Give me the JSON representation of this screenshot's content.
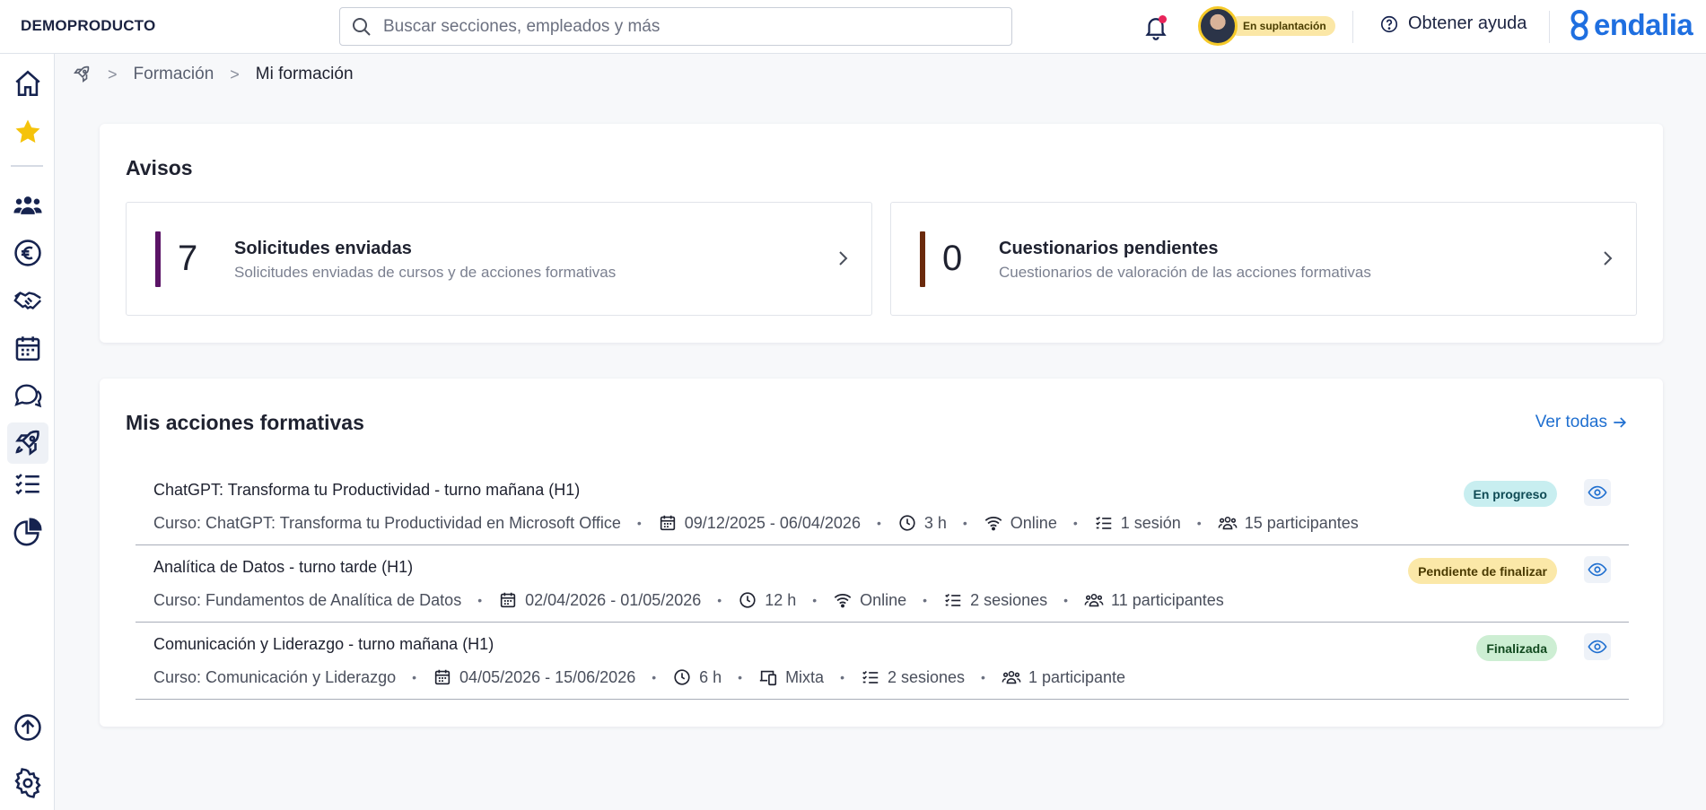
{
  "header": {
    "brand": "DEMOPRODUCTO",
    "search_placeholder": "Buscar secciones, empleados y más",
    "impersonation_label": "En suplantación",
    "help_label": "Obtener ayuda",
    "logo_text": "endalia"
  },
  "breadcrumb": {
    "section": "Formación",
    "current": "Mi formación"
  },
  "avisos": {
    "title": "Avisos",
    "items": [
      {
        "count": "7",
        "title": "Solicitudes enviadas",
        "subtitle": "Solicitudes enviadas de cursos y de acciones formativas",
        "color": "#5b1466"
      },
      {
        "count": "0",
        "title": "Cuestionarios pendientes",
        "subtitle": "Cuestionarios de valoración de las acciones formativas",
        "color": "#6b2a0c"
      }
    ]
  },
  "acciones": {
    "title": "Mis acciones formativas",
    "ver_todas": "Ver todas",
    "rows": [
      {
        "title": "ChatGPT: Transforma tu Productividad - turno mañana (H1)",
        "course": "Curso: ChatGPT: Transforma tu Productividad en Microsoft Office",
        "dates": "09/12/2025 - 06/04/2026",
        "hours": "3 h",
        "modality": "Online",
        "sessions": "1 sesión",
        "participants": "15 participantes",
        "status": "En progreso"
      },
      {
        "title": "Analítica de Datos - turno tarde (H1)",
        "course": "Curso: Fundamentos de Analítica de Datos",
        "dates": "02/04/2026 - 01/05/2026",
        "hours": "12 h",
        "modality": "Online",
        "sessions": "2 sesiones",
        "participants": "11 participantes",
        "status": "Pendiente de finalizar"
      },
      {
        "title": "Comunicación y Liderazgo - turno mañana (H1)",
        "course": "Curso: Comunicación y Liderazgo",
        "dates": "04/05/2026 - 15/06/2026",
        "hours": "6 h",
        "modality": "Mixta",
        "sessions": "2 sesiones",
        "participants": "1 participante",
        "status": "Finalizada"
      }
    ]
  },
  "colors": {
    "accent": "#1f6fd0",
    "nav_icon": "#16234f",
    "badge_in_progress_bg": "#c8eef0",
    "badge_pending_bg": "#fbe8a8",
    "badge_done_bg": "#cdeed3"
  }
}
